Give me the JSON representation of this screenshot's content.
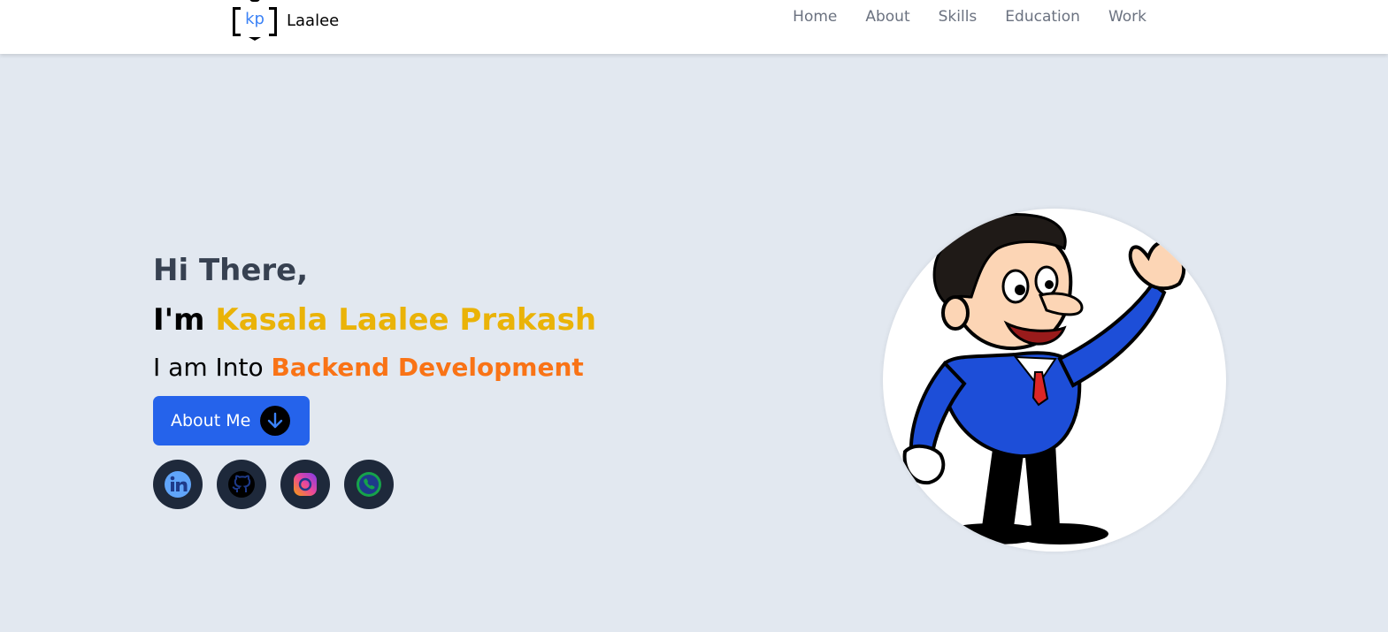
{
  "brand": {
    "logo_text": "kp",
    "name": "Laalee"
  },
  "nav": {
    "items": [
      "Home",
      "About",
      "Skills",
      "Education",
      "Work"
    ]
  },
  "hero": {
    "greeting": "Hi There,",
    "im": "I'm",
    "name": "Kasala Laalee Prakash",
    "into_prefix": "I am Into",
    "role": "Backend Development",
    "about_button": "About Me"
  },
  "socials": [
    "linkedin-icon",
    "github-icon",
    "instagram-icon",
    "whatsapp-icon"
  ],
  "colors": {
    "background": "#e2e8f0",
    "name_accent": "#eab308",
    "role_accent": "#f97316",
    "button": "#2563eb",
    "social_bg": "#1e293b"
  }
}
